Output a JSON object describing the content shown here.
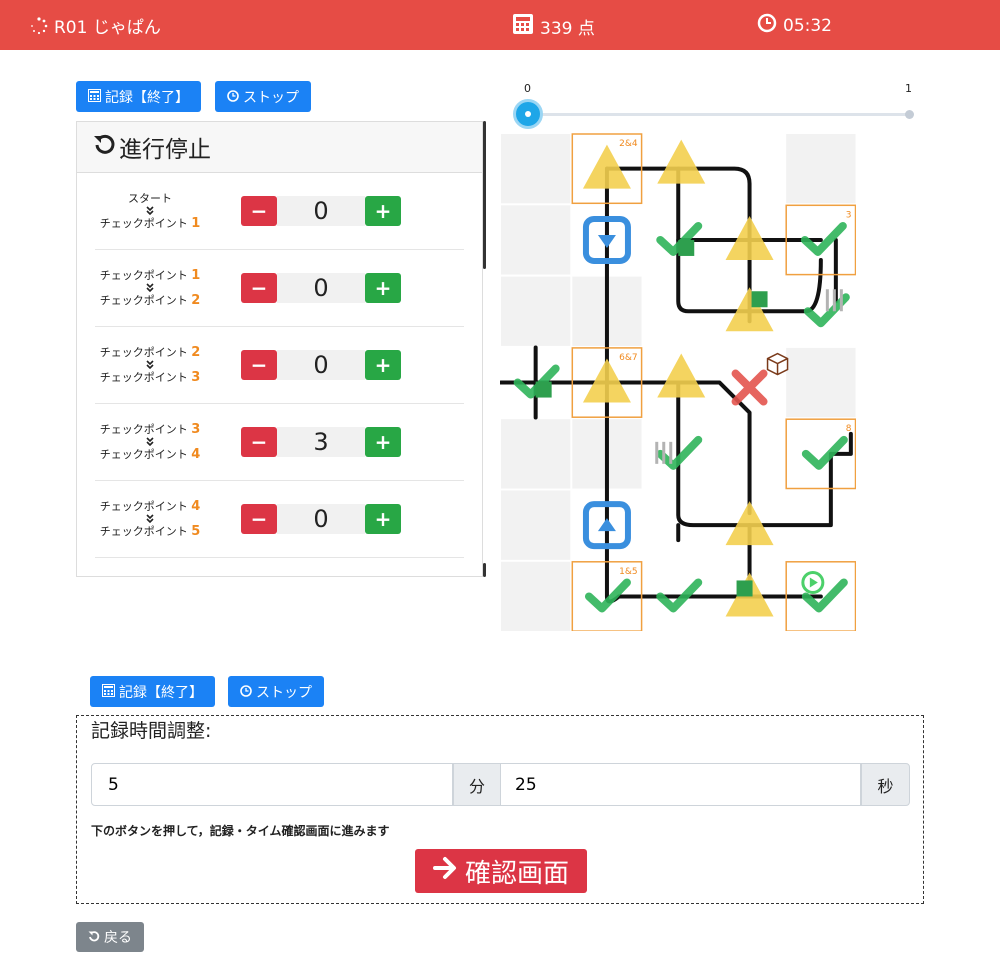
{
  "header": {
    "title": "R01 じゃぱん",
    "score": "339 点",
    "timer": "05:32"
  },
  "toolbar_top": {
    "record": "記録【終了】",
    "stop": "ストップ"
  },
  "progress": {
    "start_label": "0",
    "end_label": "1",
    "value": 0
  },
  "panel": {
    "title": "進行停止",
    "sections": [
      {
        "from": "スタート",
        "from_num": "",
        "to": "チェックポイント",
        "to_num": "1",
        "value": "0"
      },
      {
        "from": "チェックポイント",
        "from_num": "1",
        "to": "チェックポイント",
        "to_num": "2",
        "value": "0"
      },
      {
        "from": "チェックポイント",
        "from_num": "2",
        "to": "チェックポイント",
        "to_num": "3",
        "value": "0"
      },
      {
        "from": "チェックポイント",
        "from_num": "3",
        "to": "チェックポイント",
        "to_num": "4",
        "value": "3"
      },
      {
        "from": "チェックポイント",
        "from_num": "4",
        "to": "チェックポイント",
        "to_num": "5",
        "value": "0"
      }
    ]
  },
  "map": {
    "tile_labels": [
      "2&4",
      "3",
      "6&7",
      "8",
      "1&5"
    ]
  },
  "toolbar_bottom": {
    "record": "記録【終了】",
    "stop": "ストップ"
  },
  "time_adjust": {
    "title": "記録時間調整:",
    "minutes": "5",
    "minutes_unit": "分",
    "seconds": "25",
    "seconds_unit": "秒",
    "note": "下のボタンを押して，記録・タイム確認画面に進みます",
    "confirm": "確認画面"
  },
  "back": "戻る",
  "colors": {
    "header": "#e64c45",
    "primary": "#1b82f5",
    "orange": "#f08a1f"
  }
}
